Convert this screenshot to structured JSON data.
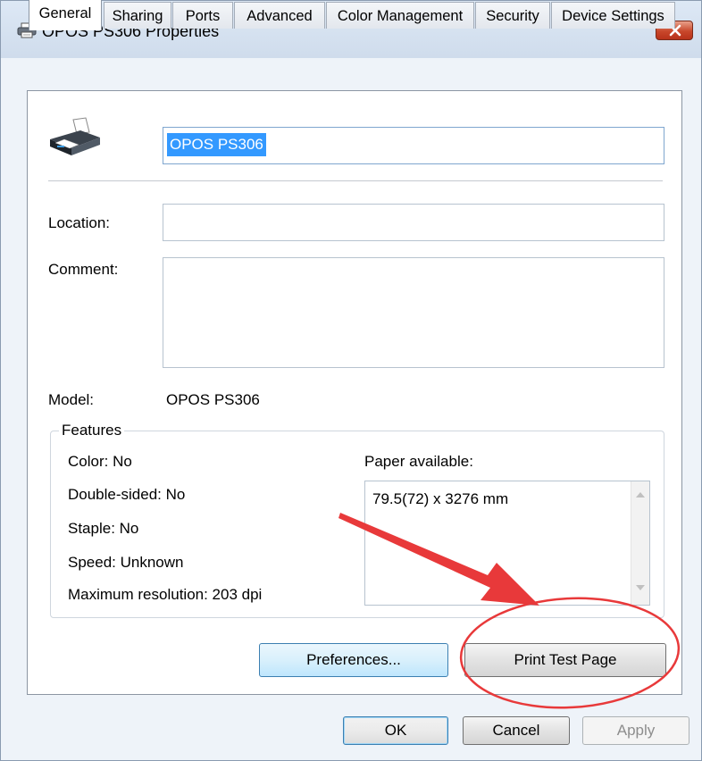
{
  "window": {
    "title": "OPOS PS306 Properties",
    "icon": "printer-icon",
    "close_icon": "close-icon"
  },
  "tabs": [
    {
      "label": "General",
      "active": true
    },
    {
      "label": "Sharing",
      "active": false
    },
    {
      "label": "Ports",
      "active": false
    },
    {
      "label": "Advanced",
      "active": false
    },
    {
      "label": "Color Management",
      "active": false
    },
    {
      "label": "Security",
      "active": false
    },
    {
      "label": "Device Settings",
      "active": false
    }
  ],
  "general": {
    "printer_name": "OPOS PS306",
    "location_label": "Location:",
    "location_value": "",
    "comment_label": "Comment:",
    "comment_value": "",
    "model_label": "Model:",
    "model_value": "OPOS PS306"
  },
  "features": {
    "title": "Features",
    "color": "Color: No",
    "double_sided": "Double-sided: No",
    "staple": "Staple: No",
    "speed": "Speed: Unknown",
    "max_resolution": "Maximum resolution: 203 dpi",
    "paper_label": "Paper available:",
    "paper_items": [
      "79.5(72) x 3276 mm"
    ]
  },
  "buttons": {
    "preferences": "Preferences...",
    "print_test_page": "Print Test Page",
    "ok": "OK",
    "cancel": "Cancel",
    "apply": "Apply"
  },
  "annotation": {
    "color": "#e8393a"
  }
}
